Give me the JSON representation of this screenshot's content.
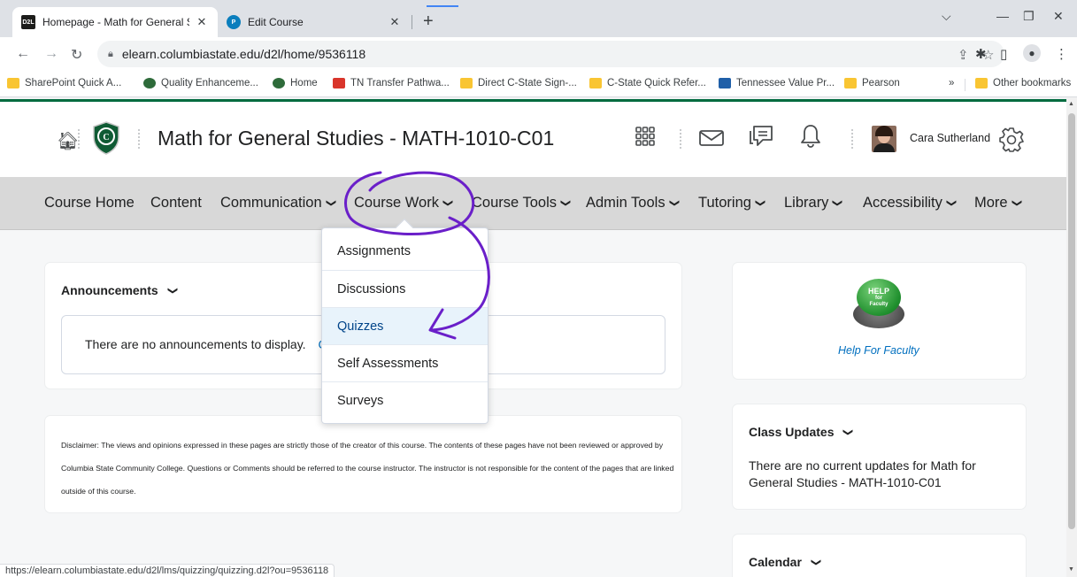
{
  "browser": {
    "tabs": [
      {
        "title": "Homepage - Math for General St",
        "favicon": "D2L",
        "active": true
      },
      {
        "title": "Edit Course",
        "favicon": "pearson-icon",
        "active": false
      }
    ],
    "url": "elearn.columbiastate.edu/d2l/home/9536118",
    "bookmarks": [
      {
        "label": "SharePoint Quick A...",
        "icon": "folder-icon"
      },
      {
        "label": "Quality Enhanceme...",
        "icon": "columbia-state-icon"
      },
      {
        "label": "Home",
        "icon": "columbia-state-icon"
      },
      {
        "label": "TN Transfer Pathwa...",
        "icon": "tn-transfer-icon"
      },
      {
        "label": "Direct C-State Sign-...",
        "icon": "folder-icon"
      },
      {
        "label": "C-State Quick Refer...",
        "icon": "folder-icon"
      },
      {
        "label": "Tennessee Value Pr...",
        "icon": "tennessee-value-icon"
      },
      {
        "label": "Pearson",
        "icon": "folder-icon"
      }
    ],
    "bookmarks_overflow": "»",
    "other_bookmarks": "Other bookmarks",
    "status_url": "https://elearn.columbiastate.edu/d2l/lms/quizzing/quizzing.d2l?ou=9536118"
  },
  "header": {
    "course_title": "Math for General Studies - MATH-1010-C01",
    "user_name": "Cara Sutherland"
  },
  "nav": {
    "items": [
      {
        "label": "Course Home",
        "has_menu": false
      },
      {
        "label": "Content",
        "has_menu": false
      },
      {
        "label": "Communication",
        "has_menu": true
      },
      {
        "label": "Course Work",
        "has_menu": true
      },
      {
        "label": "Course Tools",
        "has_menu": true
      },
      {
        "label": "Admin Tools",
        "has_menu": true
      },
      {
        "label": "Tutoring",
        "has_menu": true
      },
      {
        "label": "Library",
        "has_menu": true
      },
      {
        "label": "Accessibility",
        "has_menu": true
      },
      {
        "label": "More",
        "has_menu": true
      }
    ],
    "open_menu": "Course Work"
  },
  "dropdown": {
    "items": [
      {
        "label": "Assignments",
        "active": false
      },
      {
        "label": "Discussions",
        "active": false
      },
      {
        "label": "Quizzes",
        "active": true
      },
      {
        "label": "Self Assessments",
        "active": false
      },
      {
        "label": "Surveys",
        "active": false
      }
    ]
  },
  "announcements": {
    "title": "Announcements",
    "empty_text": "There are no announcements to display.",
    "link_fragment": "C"
  },
  "disclaimer": {
    "text": "Disclaimer: The views and opinions expressed in these pages are strictly those of the creator of this course. The contents of these pages have not been reviewed or approved by Columbia State Community College. Questions or Comments should be referred to the course instructor. The instructor is not responsible for the content of the pages that are linked outside of this course."
  },
  "help": {
    "button_line1": "HELP",
    "button_line2": "for",
    "button_line3": "Faculty",
    "link": "Help For Faculty"
  },
  "class_updates": {
    "title": "Class Updates",
    "text": "There are no current updates for Math for General Studies - MATH-1010-C01"
  },
  "calendar": {
    "title": "Calendar"
  },
  "colors": {
    "brand_green": "#006b3f",
    "link_blue": "#006fbf",
    "annotation_purple": "#6a1fc9",
    "nav_bg": "#d8d8d8"
  }
}
